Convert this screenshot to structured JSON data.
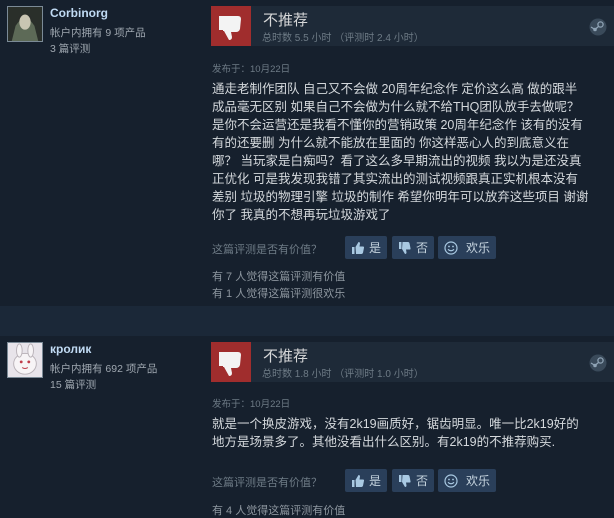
{
  "reviews": [
    {
      "username": "Corbinorg",
      "products_owned": "帐户内拥有 9 项产品",
      "review_count": "3 篇评测",
      "verdict": "不推荐",
      "hours": "总时数 5.5 小时 （评测时 2.4 小时）",
      "posted": "发布于：10月22日",
      "body": "通走老制作团队 自己又不会做 20周年纪念作 定价这么高 做的跟半\n成品毫无区别 如果自己不会做为什么就不给THQ团队放手去做呢？\n是你不会运营还是我看不懂你的营销政策 20周年纪念作 该有的没有\n有的还要删 为什么就不能放在里面的 你这样恶心人的到底意义在\n哪？ 当玩家是白痴吗？看了这么多早期流出的视频 我以为是还没真\n正优化 可是我发现我错了其实流出的测试视频跟真正实机根本没有\n差别 垃圾的物理引擎 垃圾的制作 希望你明年可以放弃这些项目 谢谢\n你了 我真的不想再玩垃圾游戏了",
      "helpful_question": "这篇评测是否有价值？",
      "btn_yes": "是",
      "btn_no": "否",
      "btn_funny": "欢乐",
      "helpful_stat": "有 7 人觉得这篇评测有价值",
      "funny_stat": "有 1 人觉得这篇评测很欢乐"
    },
    {
      "username": "кролик",
      "products_owned": "帐户内拥有 692 项产品",
      "review_count": "15 篇评测",
      "verdict": "不推荐",
      "hours": "总时数 1.8 小时 （评测时 1.0 小时）",
      "posted": "发布于：10月22日",
      "body": "就是一个换皮游戏，没有2k19画质好，锯齿明显。唯一比2k19好的\n地方是场景多了。其他没看出什么区别。有2k19的不推荐购买.",
      "helpful_question": "这篇评测是否有价值？",
      "btn_yes": "是",
      "btn_no": "否",
      "btn_funny": "欢乐",
      "helpful_stat": "有 4 人觉得这篇评测有价值"
    }
  ],
  "icons": {
    "verdict": "thumbs-down-icon",
    "steam": "steam-logo-icon",
    "yes": "thumbs-up-icon",
    "no": "thumbs-down-icon",
    "funny": "smiley-icon"
  },
  "colors": {
    "background": "#1b2838",
    "card": "#16202d",
    "thumb_red": "#a02d2d",
    "username": "#c1dbf4"
  }
}
